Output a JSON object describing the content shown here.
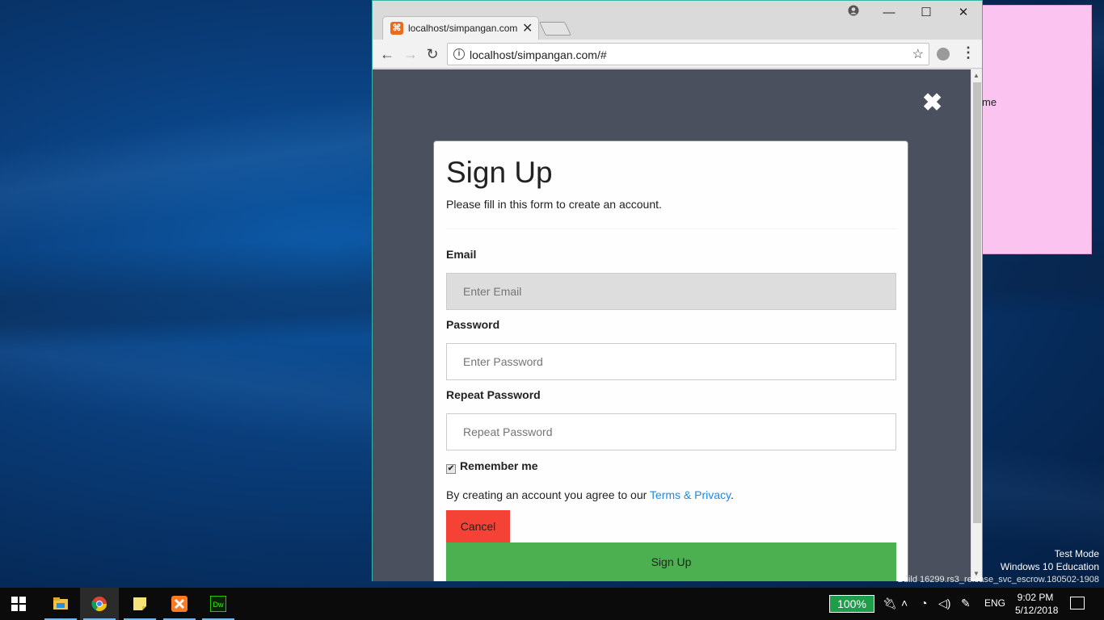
{
  "desktop": {
    "sticky_note_text": "me",
    "watermark": {
      "line1": "Test Mode",
      "line2": "Windows 10 Education",
      "line3": "Build 16299.rs3_release_svc_escrow.180502-1908"
    }
  },
  "browser": {
    "tab_title": "localhost/simpangan.com",
    "tab_close": "✕",
    "url": "localhost/simpangan.com/#",
    "controls": {
      "minimize": "—",
      "maximize": "☐",
      "close": "✕"
    }
  },
  "modal": {
    "close_symbol": "✖",
    "title": "Sign Up",
    "subtitle": "Please fill in this form to create an account.",
    "email_label": "Email",
    "email_placeholder": "Enter Email",
    "password_label": "Password",
    "password_placeholder": "Enter Password",
    "repeat_label": "Repeat Password",
    "repeat_placeholder": "Repeat Password",
    "remember_label": "Remember me",
    "remember_checked": true,
    "terms_prefix": "By creating an account you agree to our ",
    "terms_link": "Terms & Privacy",
    "terms_suffix": ".",
    "cancel_label": "Cancel",
    "signup_label": "Sign Up"
  },
  "taskbar": {
    "battery": "100%",
    "language": "ENG",
    "time": "9:02 PM",
    "date": "5/12/2018",
    "apps": [
      "file-explorer",
      "chrome",
      "sticky-notes",
      "xampp",
      "dreamweaver"
    ],
    "active_app": "chrome",
    "colors": {
      "battery_bg": "#1e9e4a",
      "cancel_bg": "#f44336",
      "signup_bg": "#4caf50",
      "link": "#1e88e5"
    }
  }
}
